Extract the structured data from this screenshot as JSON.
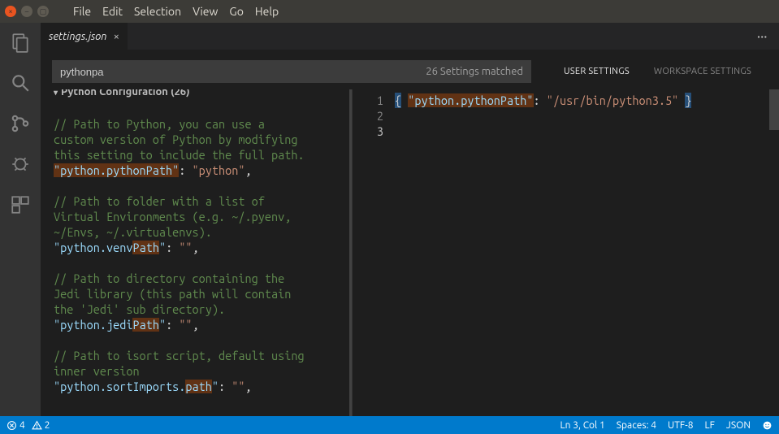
{
  "menubar": [
    "File",
    "Edit",
    "Selection",
    "View",
    "Go",
    "Help"
  ],
  "tab": {
    "title": "settings.json"
  },
  "search": {
    "query": "pythonpa",
    "matches": "26 Settings matched"
  },
  "scopes": {
    "user": "USER SETTINGS",
    "workspace": "WORKSPACE SETTINGS"
  },
  "section": {
    "title": "Python Configuration (26)"
  },
  "defaults": {
    "c1a": "// Path to Python, you can use a",
    "c1b": "custom version of Python by modifying",
    "c1c": "this setting to include the full path.",
    "k1": "\"python.pythonPath\"",
    "v1": "\"python\"",
    "c2a": "// Path to folder with a list of",
    "c2b": "Virtual Environments (e.g. ~/.pyenv,",
    "c2c": "~/Envs, ~/.virtualenvs).",
    "k2": "\"python.venvPath\"",
    "v2": "\"\"",
    "c3a": "// Path to directory containing the",
    "c3b": "Jedi library (this path will contain",
    "c3c": "the 'Jedi' sub directory).",
    "k3": "\"python.jediPath\"",
    "v3": "\"\"",
    "c4a": "// Path to isort script, default using",
    "c4b": "inner version",
    "k4": "\"python.sortImports.path\"",
    "v4": "\"\""
  },
  "user": {
    "line1": "{",
    "key": "\"python.pythonPath\"",
    "val": "\"/usr/bin/python3.5\"",
    "line3": "}"
  },
  "gutter": {
    "l1": "1",
    "l2": "2",
    "l3": "3"
  },
  "status": {
    "errors": "4",
    "warnings": "2",
    "lncol": "Ln 3, Col 1",
    "spaces": "Spaces: 4",
    "encoding": "UTF-8",
    "eol": "LF",
    "lang": "JSON"
  }
}
